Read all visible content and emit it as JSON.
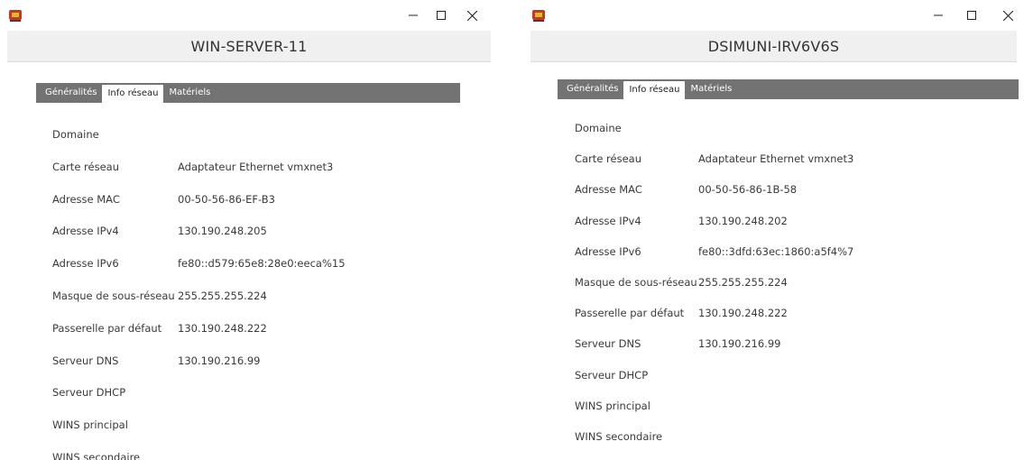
{
  "windows": [
    {
      "title": "WIN-SERVER-11",
      "tabs": [
        "Généralités",
        "Info réseau",
        "Matériels"
      ],
      "active_tab": 1,
      "rows": [
        {
          "label": "Domaine",
          "value": ""
        },
        {
          "label": "Carte réseau",
          "value": "Adaptateur Ethernet vmxnet3"
        },
        {
          "label": "Adresse MAC",
          "value": "00-50-56-86-EF-B3"
        },
        {
          "label": "Adresse IPv4",
          "value": "130.190.248.205"
        },
        {
          "label": "Adresse IPv6",
          "value": "fe80::d579:65e8:28e0:eeca%15"
        },
        {
          "label": "Masque de sous-réseau",
          "value": "255.255.255.224"
        },
        {
          "label": "Passerelle par défaut",
          "value": "130.190.248.222"
        },
        {
          "label": "Serveur DNS",
          "value": "130.190.216.99"
        },
        {
          "label": "Serveur DHCP",
          "value": ""
        },
        {
          "label": "WINS principal",
          "value": ""
        },
        {
          "label": "WINS secondaire",
          "value": ""
        }
      ]
    },
    {
      "title": "DSIMUNI-IRV6V6S",
      "tabs": [
        "Généralités",
        "Info réseau",
        "Matériels"
      ],
      "active_tab": 1,
      "rows": [
        {
          "label": "Domaine",
          "value": ""
        },
        {
          "label": "Carte réseau",
          "value": "Adaptateur Ethernet vmxnet3"
        },
        {
          "label": "Adresse MAC",
          "value": "00-50-56-86-1B-58"
        },
        {
          "label": "Adresse IPv4",
          "value": "130.190.248.202"
        },
        {
          "label": "Adresse IPv6",
          "value": "fe80::3dfd:63ec:1860:a5f4%7"
        },
        {
          "label": "Masque de sous-réseau",
          "value": "255.255.255.224"
        },
        {
          "label": "Passerelle par défaut",
          "value": "130.190.248.222"
        },
        {
          "label": "Serveur DNS",
          "value": "130.190.216.99"
        },
        {
          "label": "Serveur DHCP",
          "value": ""
        },
        {
          "label": "WINS principal",
          "value": ""
        },
        {
          "label": "WINS secondaire",
          "value": ""
        }
      ]
    }
  ],
  "window_controls": {
    "minimize": "—",
    "maximize": "☐",
    "close": "✕"
  },
  "icons": [
    "app-icon",
    "minimize-icon",
    "maximize-icon",
    "close-icon"
  ],
  "colors": {
    "tabbar": "#737373",
    "header_bg": "#f0f0f0",
    "icon_red": "#c0392b",
    "icon_yellow": "#e5b728"
  }
}
